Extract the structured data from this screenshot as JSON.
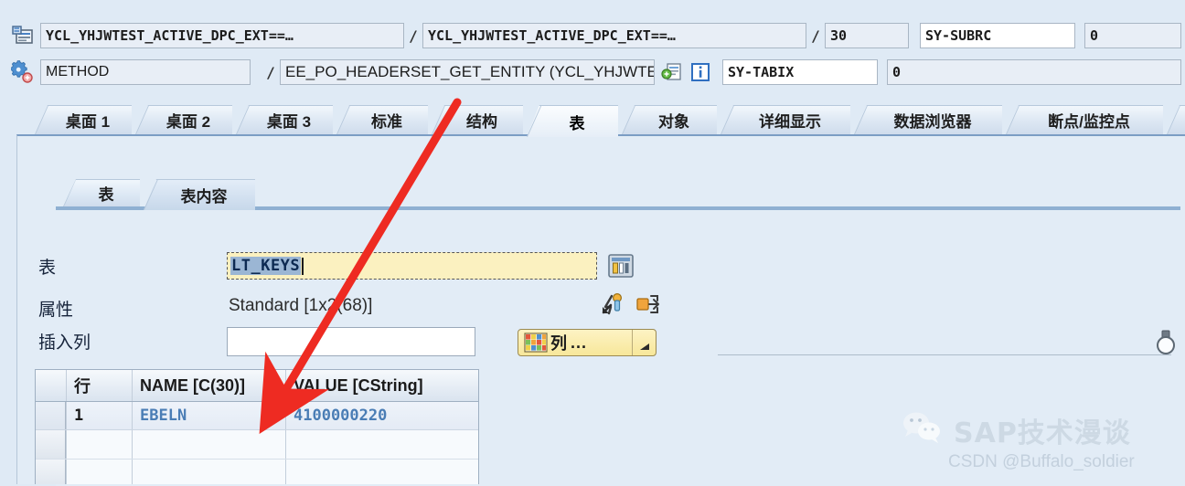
{
  "header": {
    "row1": {
      "icon": "program-screen-icon",
      "program": "YCL_YHJWTEST_ACTIVE_DPC_EXT==…",
      "separator1": "/",
      "include": "YCL_YHJWTEST_ACTIVE_DPC_EXT==…",
      "separator2": "/",
      "line": "30",
      "sysfield_name": "SY-SUBRC",
      "sysfield_value": "0"
    },
    "row2": {
      "icon": "method-gear-icon",
      "event_type": "METHOD",
      "separator1": "/",
      "event_name": "EE_PO_HEADERSET_GET_ENTITY (YCL_YHJWTEST_A…",
      "detail_icon": "display-details-icon",
      "info_icon": "information-icon",
      "sysfield_name": "SY-TABIX",
      "sysfield_value": "0"
    }
  },
  "tabs": {
    "items": [
      {
        "label": "桌面 1",
        "selected": false
      },
      {
        "label": "桌面 2",
        "selected": false
      },
      {
        "label": "桌面 3",
        "selected": false
      },
      {
        "label": "标准",
        "selected": false
      },
      {
        "label": "结构",
        "selected": false
      },
      {
        "label": "表",
        "selected": true
      },
      {
        "label": "对象",
        "selected": false
      },
      {
        "label": "详细显示",
        "selected": false
      },
      {
        "label": "数据浏览器",
        "selected": false
      },
      {
        "label": "断点/监控点",
        "selected": false
      }
    ]
  },
  "inner_tabs": {
    "items": [
      {
        "label": "表",
        "selected": false
      },
      {
        "label": "表内容",
        "selected": true
      }
    ]
  },
  "form": {
    "table_label": "表",
    "table_value": "LT_KEYS",
    "table_display_icon": "table-display-icon",
    "attributes_label": "属性",
    "attributes_value": "Standard [1x2(68)]",
    "attr_icon_1": "goto-detail-icon",
    "attr_icon_2": "export-arrows-icon",
    "insert_column_label": "插入列",
    "insert_column_value": "",
    "columns_button_label": "列",
    "columns_button_dots": "...",
    "columns_button_icon": "columns-grid-icon",
    "columns_button_arrow": "dropdown-arrow-icon"
  },
  "grid": {
    "headers": [
      "",
      "行",
      "NAME [C(30)]",
      "VALUE [CString]"
    ],
    "rows": [
      {
        "select": "",
        "row": "1",
        "name": "EBELN",
        "value": "4100000220"
      },
      {
        "select": "",
        "row": "",
        "name": "",
        "value": ""
      },
      {
        "select": "",
        "row": "",
        "name": "",
        "value": ""
      }
    ]
  },
  "hint": {
    "bulb_icon": "lightbulb-icon"
  },
  "watermark": {
    "logo": "wechat-logo-icon",
    "title": "SAP技术漫谈",
    "subtitle": "CSDN @Buffalo_soldier"
  },
  "annotation": {
    "arrow": "red-arrow-annotation",
    "color": "#ee2b22"
  },
  "colors": {
    "background": "#dfeaf5",
    "panel": "#e2ecf6",
    "accent": "#7b9dc4",
    "input_focus": "#fbf1c0",
    "data_text": "#4a7db5",
    "annotation": "#ee2b22"
  }
}
